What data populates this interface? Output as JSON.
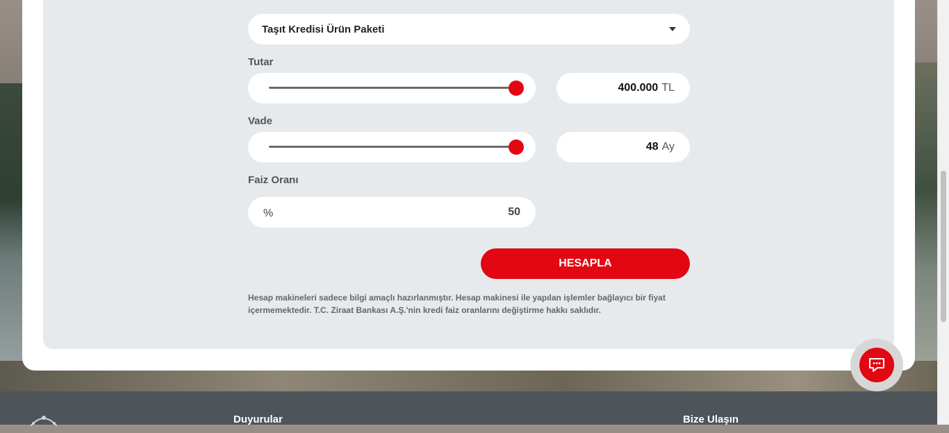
{
  "product_select": {
    "label": "Taşıt Kredisi Ürün Paketi"
  },
  "amount": {
    "label": "Tutar",
    "value": "400.000",
    "unit": "TL",
    "slider_fraction": 1.0
  },
  "term": {
    "label": "Vade",
    "value": "48",
    "unit": "Ay",
    "slider_fraction": 1.0
  },
  "rate": {
    "label": "Faiz Oranı",
    "symbol": "%",
    "value": "50"
  },
  "calculate_button": {
    "label": "HESAPLA"
  },
  "disclaimer": "Hesap makineleri sadece bilgi amaçlı hazırlanmıştır. Hesap makinesi ile yapılan işlemler bağlayıcı bir fiyat içermemektedir. T.C. Ziraat Bankası A.Ş.'nin kredi faiz oranlarını değiştirme hakkı saklıdır.",
  "footer": {
    "col1_title": "Duyurular",
    "col2_title": "Bize Ulaşın"
  },
  "colors": {
    "accent": "#e30613",
    "panel": "#e6eaed",
    "footer": "#4d555b"
  },
  "icons": {
    "chat": "chat-bubble-icon",
    "dropdown": "chevron-down-icon",
    "logo": "bank-logo-icon"
  }
}
